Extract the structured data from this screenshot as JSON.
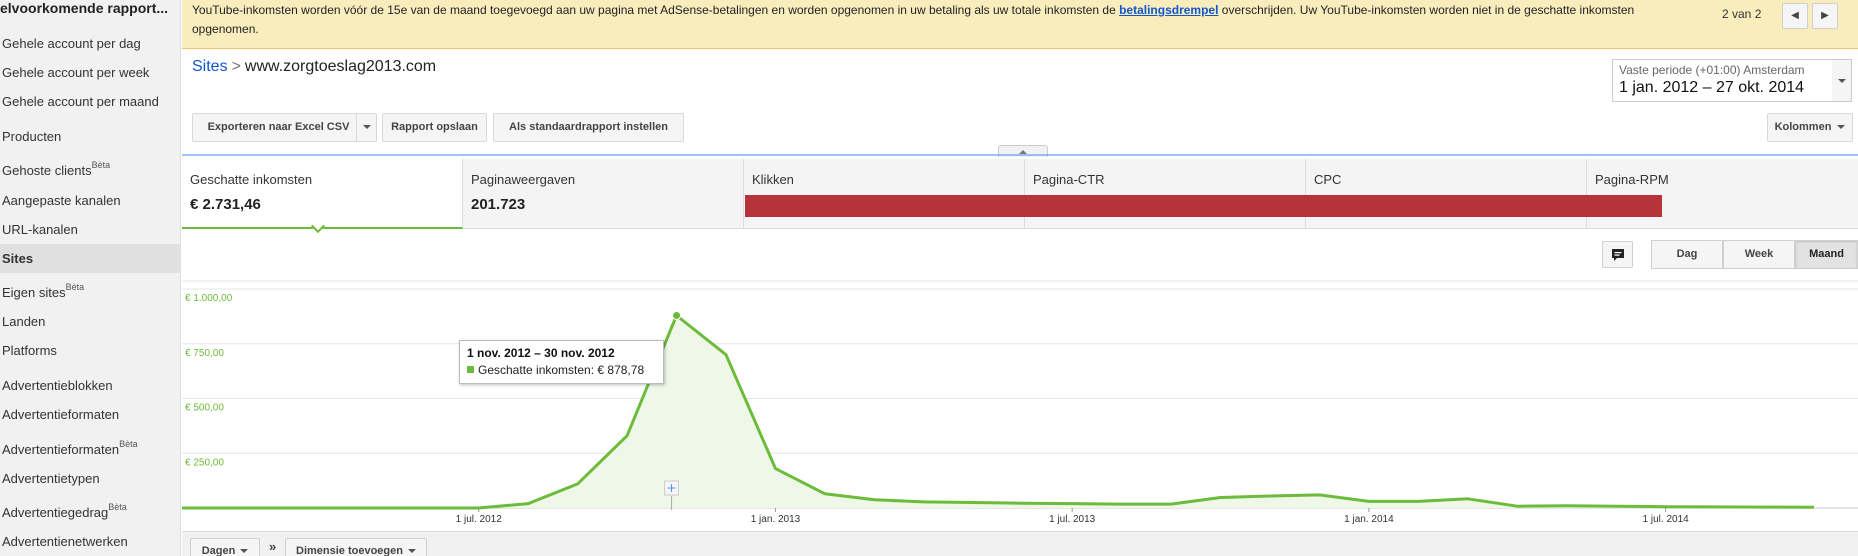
{
  "sidebar": {
    "title": "elvoorkomende rapport...",
    "items": [
      {
        "label": "Gehele account per dag",
        "top": 36
      },
      {
        "label": "Gehele account per week",
        "top": 65
      },
      {
        "label": "Gehele account per maand",
        "top": 94
      },
      {
        "label": "Producten",
        "top": 129
      },
      {
        "label": "Gehoste clients",
        "badge": "Bèta",
        "top": 163
      },
      {
        "label": "Aangepaste kanalen",
        "top": 193
      },
      {
        "label": "URL-kanalen",
        "top": 222
      },
      {
        "label": "Sites",
        "active": true,
        "top": 244
      },
      {
        "label": "Eigen sites",
        "badge": "Bèta",
        "top": 285
      },
      {
        "label": "Landen",
        "top": 314
      },
      {
        "label": "Platforms",
        "top": 343
      },
      {
        "label": "Advertentieblokken",
        "top": 378
      },
      {
        "label": "Advertentieformaten",
        "top": 407
      },
      {
        "label": "Advertentieformaten",
        "badge": "Bèta",
        "top": 442
      },
      {
        "label": "Advertentietypen",
        "top": 471
      },
      {
        "label": "Advertentiegedrag",
        "badge": "Bèta",
        "top": 505
      },
      {
        "label": "Advertentienetwerken",
        "top": 534
      }
    ]
  },
  "notice": {
    "text_before": "YouTube-inkomsten worden vóór de 15e van de maand toegevoegd aan uw pagina met AdSense-betalingen en worden opgenomen in uw betaling als uw totale inkomsten de ",
    "link": "betalingsdrempel",
    "text_after": " overschrijden. Uw YouTube-inkomsten worden niet in de geschatte inkomsten opgenomen.",
    "pager": "2 van 2",
    "prev_icon": "triangle-left-icon",
    "next_icon": "triangle-right-icon"
  },
  "header": {
    "breadcrumb_root": "Sites",
    "breadcrumb_sep": ">",
    "breadcrumb_current": "www.zorgtoeslag2013.com",
    "period_label": "Vaste periode (+01:00) Amsterdam",
    "period_value": "1 jan. 2012 – 27 okt. 2014"
  },
  "toolbar": {
    "export_label": "Exporteren naar Excel CSV",
    "save_label": "Rapport opslaan",
    "default_label": "Als standaardrapport instellen",
    "columns_label": "Kolommen"
  },
  "metrics": [
    {
      "name": "Geschatte inkomsten",
      "value": "€ 2.731,46",
      "active": true
    },
    {
      "name": "Paginaweergaven",
      "value": "201.723"
    },
    {
      "name": "Klikken",
      "value": ""
    },
    {
      "name": "Pagina-CTR",
      "value": ""
    },
    {
      "name": "CPC",
      "value": ""
    },
    {
      "name": "Pagina-RPM",
      "value": ""
    }
  ],
  "granularity": {
    "options": [
      "Dag",
      "Week",
      "Maand"
    ],
    "selected": "Maand"
  },
  "colors": {
    "series": "#6dbb3b",
    "series_fill": "#eef7e8",
    "redaction": "#b7333a",
    "link": "#1155cc"
  },
  "tooltip": {
    "title": "1 nov. 2012 – 30 nov. 2012",
    "series_name": "Geschatte inkomsten",
    "value": "€ 878,78"
  },
  "chart_data": {
    "type": "area",
    "series": [
      {
        "name": "Geschatte inkomsten",
        "x": [
          "2012-01",
          "2012-02",
          "2012-03",
          "2012-04",
          "2012-05",
          "2012-06",
          "2012-07",
          "2012-08",
          "2012-09",
          "2012-10",
          "2012-11",
          "2012-12",
          "2013-01",
          "2013-02",
          "2013-03",
          "2013-04",
          "2013-05",
          "2013-06",
          "2013-07",
          "2013-08",
          "2013-09",
          "2013-10",
          "2013-11",
          "2013-12",
          "2014-01",
          "2014-02",
          "2014-03",
          "2014-04",
          "2014-05",
          "2014-06",
          "2014-07",
          "2014-08",
          "2014-09",
          "2014-10"
        ],
        "values": [
          0,
          0,
          0,
          0,
          0,
          0,
          0,
          20,
          110,
          330,
          878.78,
          700,
          180,
          65,
          38,
          28,
          25,
          22,
          20,
          18,
          18,
          48,
          55,
          60,
          30,
          30,
          42,
          8,
          10,
          8,
          6,
          5,
          4,
          3
        ]
      }
    ],
    "y_ticks": [
      "€ 1.000,00",
      "€ 750,00",
      "€ 500,00",
      "€ 250,00"
    ],
    "y_tick_values": [
      1000,
      750,
      500,
      250
    ],
    "ylim": [
      0,
      1000
    ],
    "x_ticks": [
      "1 jul. 2012",
      "1 jan. 2013",
      "1 jul. 2013",
      "1 jan. 2014",
      "1 jul. 2014"
    ],
    "x_tick_positions": [
      "2012-07",
      "2013-01",
      "2013-07",
      "2014-01",
      "2014-07"
    ],
    "grid": true
  },
  "bottom": {
    "days_label": "Dagen",
    "chevron": "»",
    "dimension_label": "Dimensie toevoegen"
  }
}
